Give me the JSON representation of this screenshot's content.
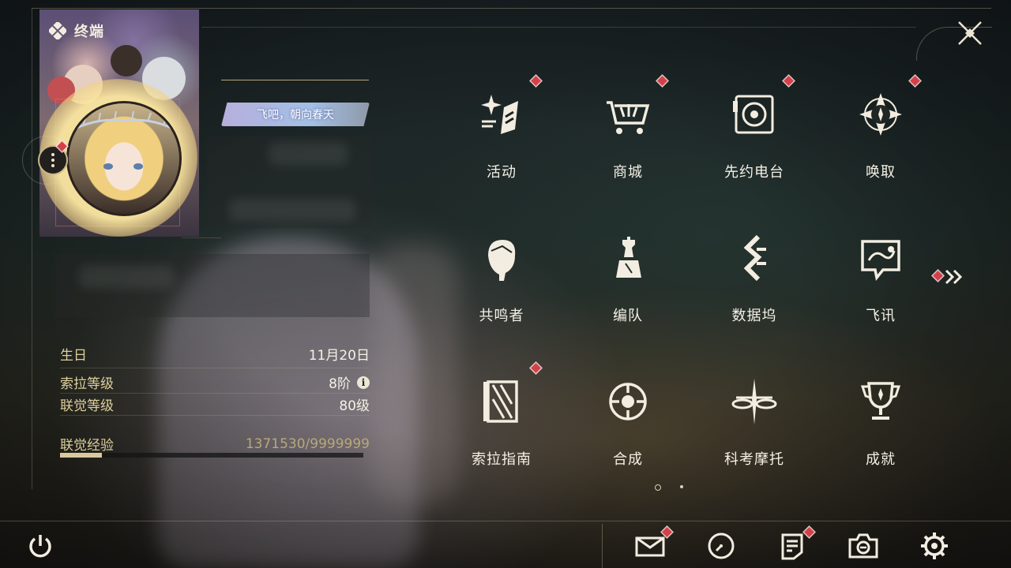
{
  "header": {
    "title": "终端",
    "title_icon": "diamond-cluster-icon",
    "close_icon": "close-x-icon"
  },
  "profile": {
    "title_plate": "飞吧，朝向春天",
    "menu_icon": "more-vertical-icon"
  },
  "stats": {
    "birthday_label": "生日",
    "birthday_value": "11月20日",
    "sola_level_label": "索拉等级",
    "sola_level_value": "8阶",
    "union_level_label": "联觉等级",
    "union_level_value": "80级",
    "exp_label": "联觉经验",
    "exp_value": "1371530/9999999",
    "exp_progress": 0.137
  },
  "menu": {
    "items": [
      {
        "label": "活动",
        "icon": "sparkle-events-icon",
        "badge": true
      },
      {
        "label": "商城",
        "icon": "shopping-cart-icon",
        "badge": true
      },
      {
        "label": "先约电台",
        "icon": "radio-speaker-icon",
        "badge": true
      },
      {
        "label": "唤取",
        "icon": "compass-star-icon",
        "badge": true
      },
      {
        "label": "共鸣者",
        "icon": "character-head-icon",
        "badge": false
      },
      {
        "label": "编队",
        "icon": "chess-team-icon",
        "badge": false
      },
      {
        "label": "数据坞",
        "icon": "data-bank-icon",
        "badge": false
      },
      {
        "label": "飞讯",
        "icon": "chat-message-icon",
        "badge": false
      },
      {
        "label": "索拉指南",
        "icon": "guide-book-icon",
        "badge": true
      },
      {
        "label": "合成",
        "icon": "synthesis-orb-icon",
        "badge": false
      },
      {
        "label": "科考摩托",
        "icon": "motorbike-icon",
        "badge": false
      },
      {
        "label": "成就",
        "icon": "trophy-icon",
        "badge": false
      }
    ],
    "next_page_icon": "double-chevron-right-icon",
    "page_count": 2,
    "current_page": 1
  },
  "bottom_bar": {
    "power_icon": "power-icon",
    "buttons": [
      {
        "name": "mail",
        "icon": "mail-icon",
        "badge": true
      },
      {
        "name": "clock",
        "icon": "clock-icon",
        "badge": false
      },
      {
        "name": "notice",
        "icon": "notice-icon",
        "badge": true
      },
      {
        "name": "camera",
        "icon": "camera-icon",
        "badge": false
      },
      {
        "name": "settings",
        "icon": "gear-icon",
        "badge": false
      }
    ]
  },
  "colors": {
    "accent_gold": "#ddcf9c",
    "badge_red": "#d4404a",
    "text_light": "#f5f1e6"
  }
}
